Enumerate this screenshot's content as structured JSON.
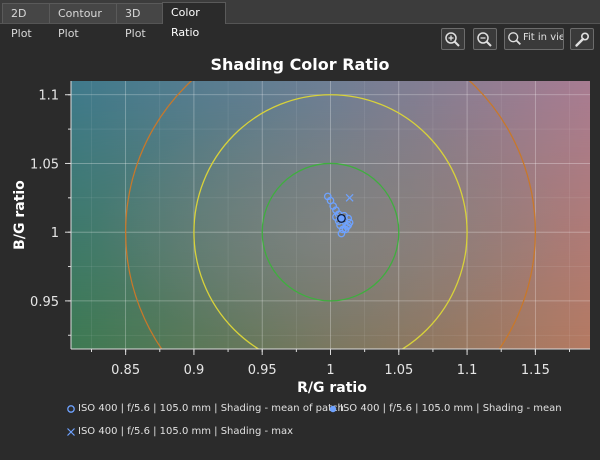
{
  "tabs": [
    {
      "label": "2D Plot",
      "active": false
    },
    {
      "label": "Contour Plot",
      "active": false
    },
    {
      "label": "3D Plot",
      "active": false
    },
    {
      "label": "Color Ratio",
      "active": true
    }
  ],
  "toolbar": {
    "zoom_in_icon": "zoom-in-icon",
    "zoom_out_icon": "zoom-out-icon",
    "fit_label": "Fit in view",
    "settings_icon": "wrench-icon"
  },
  "chart_data": {
    "type": "scatter",
    "title": "Shading Color Ratio",
    "xlabel": "R/G ratio",
    "ylabel": "B/G ratio",
    "xlim": [
      0.81,
      1.19
    ],
    "ylim": [
      0.915,
      1.11
    ],
    "xticks": [
      "0.85",
      "0.9",
      "0.95",
      "1",
      "1.05",
      "1.1",
      "1.15"
    ],
    "yticks": [
      "0.95",
      "1",
      "1.05",
      "1.1"
    ],
    "grid": true,
    "circles": [
      {
        "center": [
          1,
          1
        ],
        "radius": 0.05,
        "color": "#3fae3f"
      },
      {
        "center": [
          1,
          1
        ],
        "radius": 0.1,
        "color": "#d8d23a"
      },
      {
        "center": [
          1,
          1
        ],
        "radius": 0.15,
        "color": "#c8782a"
      }
    ],
    "series": [
      {
        "name": "ISO 400 | f/5.6 | 105.0 mm | Shading - mean of patch",
        "marker": "open-circle",
        "color": "#6ea2ff",
        "points": [
          [
            0.998,
            1.026
          ],
          [
            1.0,
            1.023
          ],
          [
            1.002,
            1.019
          ],
          [
            1.004,
            1.016
          ],
          [
            1.006,
            1.013
          ],
          [
            1.01,
            1.012
          ],
          [
            1.013,
            1.01
          ],
          [
            1.014,
            1.007
          ],
          [
            1.012,
            1.004
          ],
          [
            1.009,
            1.002
          ],
          [
            1.007,
            1.005
          ],
          [
            1.008,
            0.999
          ],
          [
            1.011,
            1.002
          ],
          [
            1.006,
            1.008
          ],
          [
            1.004,
            1.011
          ],
          [
            1.013,
            1.005
          ],
          [
            1.01,
            1.009
          ]
        ]
      },
      {
        "name": "ISO 400 | f/5.6 | 105.0 mm | Shading - mean",
        "marker": "filled-circle",
        "color": "#6ea2ff",
        "points": [
          [
            1.008,
            1.01
          ]
        ]
      },
      {
        "name": "ISO 400 | f/5.6 | 105.0 mm | Shading - max",
        "marker": "cross",
        "color": "#6ea2ff",
        "points": [
          [
            1.014,
            1.025
          ]
        ]
      }
    ],
    "legend_position": "bottom"
  }
}
